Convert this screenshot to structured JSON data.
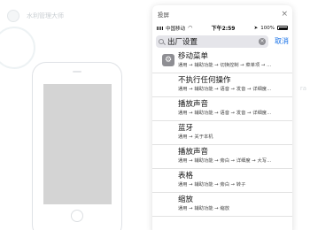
{
  "background": {
    "brand": "水利管理大师",
    "right_hint": "ra"
  },
  "popup": {
    "title": "投屏",
    "close": "×",
    "status": {
      "carrier": "中国移动",
      "time": "下午2:59",
      "battery": "100%"
    },
    "search": {
      "value": "出厂设置",
      "clear": "×",
      "cancel": "取消"
    },
    "results": [
      {
        "title": "移动菜单",
        "path": "通用 → 辅助功能 → 切换控制 → 菜单项 → ...",
        "icon": "gear-icon"
      },
      {
        "title": "不执行任何操作",
        "path": "通用 → 辅助功能 → 语音 → 发音 → 详细度..."
      },
      {
        "title": "播放声音",
        "path": "通用 → 辅助功能 → 语音 → 发音 → 详细度..."
      },
      {
        "title": "蓝牙",
        "path": "通用 → 关于本机"
      },
      {
        "title": "播放声音",
        "path": "通用 → 辅助功能 → 旁白 → 详细度 → 大写..."
      },
      {
        "title": "表格",
        "path": "通用 → 辅助功能 → 旁白 → 转子"
      },
      {
        "title": "缩放",
        "path": "通用 → 辅助功能 → 缩放"
      }
    ]
  }
}
